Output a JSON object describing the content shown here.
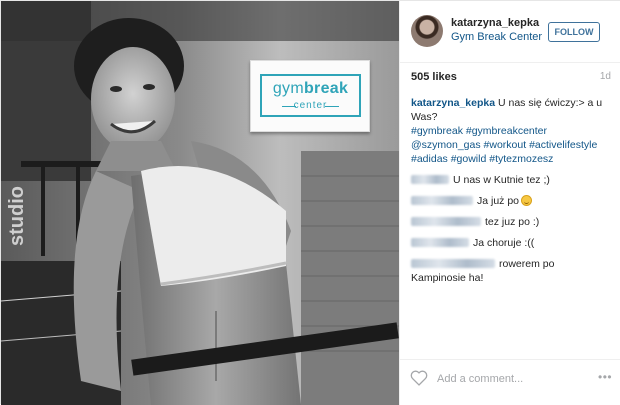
{
  "photo": {
    "alt_icon": "photo-of-woman-in-gym",
    "sign": {
      "brand_light": "gym",
      "brand_bold": "break",
      "subtitle": "center"
    }
  },
  "header": {
    "username": "katarzyna_kepka",
    "location": "Gym Break Center",
    "follow_label": "FOLLOW"
  },
  "stats": {
    "likes": "505 likes",
    "age": "1d"
  },
  "caption": {
    "username": "katarzyna_kepka",
    "text": "U nas się ćwiczy:> a u Was?",
    "hashtags": [
      "#gymbreak",
      "#gymbreakcenter",
      "@szymon_gas",
      "#workout",
      "#activelifestyle",
      "#adidas",
      "#gowild",
      "#tytezmozesz"
    ]
  },
  "comments": [
    {
      "text": "U nas w Kutnie tez ;)"
    },
    {
      "text": "Ja już po"
    },
    {
      "text": "tez juz po :)"
    },
    {
      "text": "Ja choruje :(("
    },
    {
      "text": "rowerem po Kampinosie ha!"
    }
  ],
  "footer": {
    "placeholder": "Add a comment...",
    "more_label": "•••"
  },
  "colors": {
    "link": "#125688",
    "follow": "#3f729b",
    "logo": "#2fa4b8",
    "muted": "#a5a7aa"
  }
}
